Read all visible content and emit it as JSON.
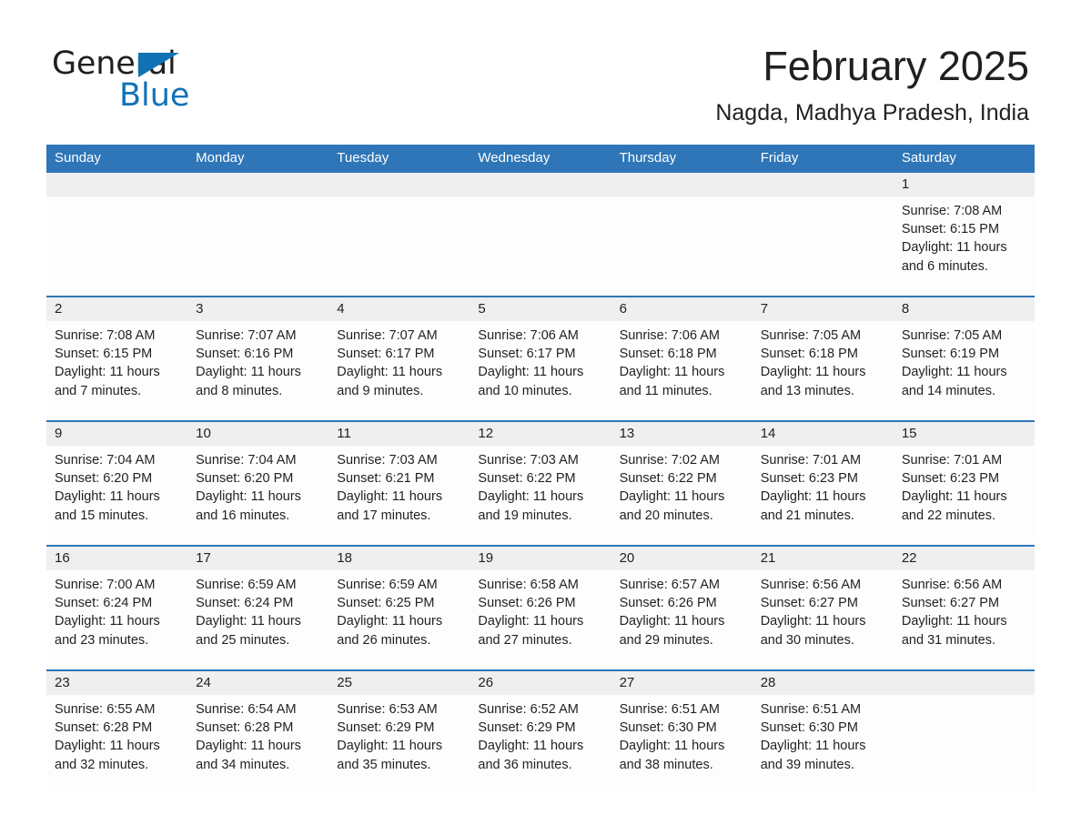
{
  "brand": {
    "name_part1": "General",
    "name_part2": "Blue",
    "accent_color": "#1272b6"
  },
  "header": {
    "month_title": "February 2025",
    "location": "Nagda, Madhya Pradesh, India"
  },
  "theme": {
    "header_row_color": "#2e76b8",
    "date_strip_color": "#efefef",
    "text_color": "#231f20"
  },
  "weekday_headers": [
    "Sunday",
    "Monday",
    "Tuesday",
    "Wednesday",
    "Thursday",
    "Friday",
    "Saturday"
  ],
  "weeks": [
    {
      "days": [
        {
          "num": "",
          "lines": [
            "",
            "",
            "",
            ""
          ]
        },
        {
          "num": "",
          "lines": [
            "",
            "",
            "",
            ""
          ]
        },
        {
          "num": "",
          "lines": [
            "",
            "",
            "",
            ""
          ]
        },
        {
          "num": "",
          "lines": [
            "",
            "",
            "",
            ""
          ]
        },
        {
          "num": "",
          "lines": [
            "",
            "",
            "",
            ""
          ]
        },
        {
          "num": "",
          "lines": [
            "",
            "",
            "",
            ""
          ]
        },
        {
          "num": "1",
          "lines": [
            "Sunrise: 7:08 AM",
            "Sunset: 6:15 PM",
            "Daylight: 11 hours",
            "and 6 minutes."
          ]
        }
      ]
    },
    {
      "days": [
        {
          "num": "2",
          "lines": [
            "Sunrise: 7:08 AM",
            "Sunset: 6:15 PM",
            "Daylight: 11 hours",
            "and 7 minutes."
          ]
        },
        {
          "num": "3",
          "lines": [
            "Sunrise: 7:07 AM",
            "Sunset: 6:16 PM",
            "Daylight: 11 hours",
            "and 8 minutes."
          ]
        },
        {
          "num": "4",
          "lines": [
            "Sunrise: 7:07 AM",
            "Sunset: 6:17 PM",
            "Daylight: 11 hours",
            "and 9 minutes."
          ]
        },
        {
          "num": "5",
          "lines": [
            "Sunrise: 7:06 AM",
            "Sunset: 6:17 PM",
            "Daylight: 11 hours",
            "and 10 minutes."
          ]
        },
        {
          "num": "6",
          "lines": [
            "Sunrise: 7:06 AM",
            "Sunset: 6:18 PM",
            "Daylight: 11 hours",
            "and 11 minutes."
          ]
        },
        {
          "num": "7",
          "lines": [
            "Sunrise: 7:05 AM",
            "Sunset: 6:18 PM",
            "Daylight: 11 hours",
            "and 13 minutes."
          ]
        },
        {
          "num": "8",
          "lines": [
            "Sunrise: 7:05 AM",
            "Sunset: 6:19 PM",
            "Daylight: 11 hours",
            "and 14 minutes."
          ]
        }
      ]
    },
    {
      "days": [
        {
          "num": "9",
          "lines": [
            "Sunrise: 7:04 AM",
            "Sunset: 6:20 PM",
            "Daylight: 11 hours",
            "and 15 minutes."
          ]
        },
        {
          "num": "10",
          "lines": [
            "Sunrise: 7:04 AM",
            "Sunset: 6:20 PM",
            "Daylight: 11 hours",
            "and 16 minutes."
          ]
        },
        {
          "num": "11",
          "lines": [
            "Sunrise: 7:03 AM",
            "Sunset: 6:21 PM",
            "Daylight: 11 hours",
            "and 17 minutes."
          ]
        },
        {
          "num": "12",
          "lines": [
            "Sunrise: 7:03 AM",
            "Sunset: 6:22 PM",
            "Daylight: 11 hours",
            "and 19 minutes."
          ]
        },
        {
          "num": "13",
          "lines": [
            "Sunrise: 7:02 AM",
            "Sunset: 6:22 PM",
            "Daylight: 11 hours",
            "and 20 minutes."
          ]
        },
        {
          "num": "14",
          "lines": [
            "Sunrise: 7:01 AM",
            "Sunset: 6:23 PM",
            "Daylight: 11 hours",
            "and 21 minutes."
          ]
        },
        {
          "num": "15",
          "lines": [
            "Sunrise: 7:01 AM",
            "Sunset: 6:23 PM",
            "Daylight: 11 hours",
            "and 22 minutes."
          ]
        }
      ]
    },
    {
      "days": [
        {
          "num": "16",
          "lines": [
            "Sunrise: 7:00 AM",
            "Sunset: 6:24 PM",
            "Daylight: 11 hours",
            "and 23 minutes."
          ]
        },
        {
          "num": "17",
          "lines": [
            "Sunrise: 6:59 AM",
            "Sunset: 6:24 PM",
            "Daylight: 11 hours",
            "and 25 minutes."
          ]
        },
        {
          "num": "18",
          "lines": [
            "Sunrise: 6:59 AM",
            "Sunset: 6:25 PM",
            "Daylight: 11 hours",
            "and 26 minutes."
          ]
        },
        {
          "num": "19",
          "lines": [
            "Sunrise: 6:58 AM",
            "Sunset: 6:26 PM",
            "Daylight: 11 hours",
            "and 27 minutes."
          ]
        },
        {
          "num": "20",
          "lines": [
            "Sunrise: 6:57 AM",
            "Sunset: 6:26 PM",
            "Daylight: 11 hours",
            "and 29 minutes."
          ]
        },
        {
          "num": "21",
          "lines": [
            "Sunrise: 6:56 AM",
            "Sunset: 6:27 PM",
            "Daylight: 11 hours",
            "and 30 minutes."
          ]
        },
        {
          "num": "22",
          "lines": [
            "Sunrise: 6:56 AM",
            "Sunset: 6:27 PM",
            "Daylight: 11 hours",
            "and 31 minutes."
          ]
        }
      ]
    },
    {
      "days": [
        {
          "num": "23",
          "lines": [
            "Sunrise: 6:55 AM",
            "Sunset: 6:28 PM",
            "Daylight: 11 hours",
            "and 32 minutes."
          ]
        },
        {
          "num": "24",
          "lines": [
            "Sunrise: 6:54 AM",
            "Sunset: 6:28 PM",
            "Daylight: 11 hours",
            "and 34 minutes."
          ]
        },
        {
          "num": "25",
          "lines": [
            "Sunrise: 6:53 AM",
            "Sunset: 6:29 PM",
            "Daylight: 11 hours",
            "and 35 minutes."
          ]
        },
        {
          "num": "26",
          "lines": [
            "Sunrise: 6:52 AM",
            "Sunset: 6:29 PM",
            "Daylight: 11 hours",
            "and 36 minutes."
          ]
        },
        {
          "num": "27",
          "lines": [
            "Sunrise: 6:51 AM",
            "Sunset: 6:30 PM",
            "Daylight: 11 hours",
            "and 38 minutes."
          ]
        },
        {
          "num": "28",
          "lines": [
            "Sunrise: 6:51 AM",
            "Sunset: 6:30 PM",
            "Daylight: 11 hours",
            "and 39 minutes."
          ]
        },
        {
          "num": "",
          "lines": [
            "",
            "",
            "",
            ""
          ]
        }
      ]
    }
  ]
}
